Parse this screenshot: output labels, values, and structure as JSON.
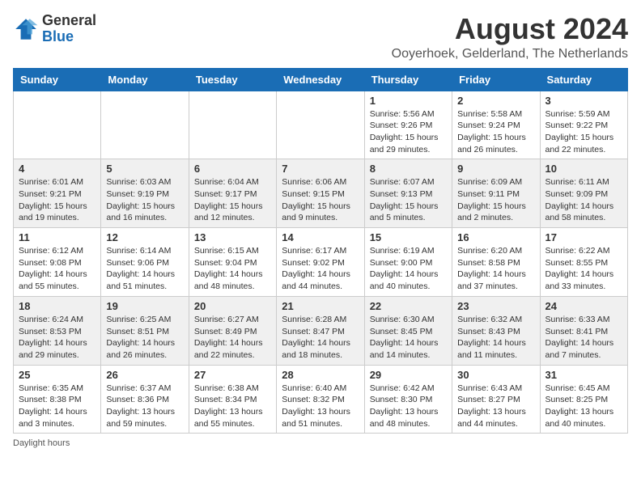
{
  "logo": {
    "line1": "General",
    "line2": "Blue"
  },
  "title": "August 2024",
  "subtitle": "Ooyerhoek, Gelderland, The Netherlands",
  "days_of_week": [
    "Sunday",
    "Monday",
    "Tuesday",
    "Wednesday",
    "Thursday",
    "Friday",
    "Saturday"
  ],
  "footer": "Daylight hours",
  "weeks": [
    [
      {
        "day": "",
        "info": ""
      },
      {
        "day": "",
        "info": ""
      },
      {
        "day": "",
        "info": ""
      },
      {
        "day": "",
        "info": ""
      },
      {
        "day": "1",
        "info": "Sunrise: 5:56 AM\nSunset: 9:26 PM\nDaylight: 15 hours\nand 29 minutes."
      },
      {
        "day": "2",
        "info": "Sunrise: 5:58 AM\nSunset: 9:24 PM\nDaylight: 15 hours\nand 26 minutes."
      },
      {
        "day": "3",
        "info": "Sunrise: 5:59 AM\nSunset: 9:22 PM\nDaylight: 15 hours\nand 22 minutes."
      }
    ],
    [
      {
        "day": "4",
        "info": "Sunrise: 6:01 AM\nSunset: 9:21 PM\nDaylight: 15 hours\nand 19 minutes."
      },
      {
        "day": "5",
        "info": "Sunrise: 6:03 AM\nSunset: 9:19 PM\nDaylight: 15 hours\nand 16 minutes."
      },
      {
        "day": "6",
        "info": "Sunrise: 6:04 AM\nSunset: 9:17 PM\nDaylight: 15 hours\nand 12 minutes."
      },
      {
        "day": "7",
        "info": "Sunrise: 6:06 AM\nSunset: 9:15 PM\nDaylight: 15 hours\nand 9 minutes."
      },
      {
        "day": "8",
        "info": "Sunrise: 6:07 AM\nSunset: 9:13 PM\nDaylight: 15 hours\nand 5 minutes."
      },
      {
        "day": "9",
        "info": "Sunrise: 6:09 AM\nSunset: 9:11 PM\nDaylight: 15 hours\nand 2 minutes."
      },
      {
        "day": "10",
        "info": "Sunrise: 6:11 AM\nSunset: 9:09 PM\nDaylight: 14 hours\nand 58 minutes."
      }
    ],
    [
      {
        "day": "11",
        "info": "Sunrise: 6:12 AM\nSunset: 9:08 PM\nDaylight: 14 hours\nand 55 minutes."
      },
      {
        "day": "12",
        "info": "Sunrise: 6:14 AM\nSunset: 9:06 PM\nDaylight: 14 hours\nand 51 minutes."
      },
      {
        "day": "13",
        "info": "Sunrise: 6:15 AM\nSunset: 9:04 PM\nDaylight: 14 hours\nand 48 minutes."
      },
      {
        "day": "14",
        "info": "Sunrise: 6:17 AM\nSunset: 9:02 PM\nDaylight: 14 hours\nand 44 minutes."
      },
      {
        "day": "15",
        "info": "Sunrise: 6:19 AM\nSunset: 9:00 PM\nDaylight: 14 hours\nand 40 minutes."
      },
      {
        "day": "16",
        "info": "Sunrise: 6:20 AM\nSunset: 8:58 PM\nDaylight: 14 hours\nand 37 minutes."
      },
      {
        "day": "17",
        "info": "Sunrise: 6:22 AM\nSunset: 8:55 PM\nDaylight: 14 hours\nand 33 minutes."
      }
    ],
    [
      {
        "day": "18",
        "info": "Sunrise: 6:24 AM\nSunset: 8:53 PM\nDaylight: 14 hours\nand 29 minutes."
      },
      {
        "day": "19",
        "info": "Sunrise: 6:25 AM\nSunset: 8:51 PM\nDaylight: 14 hours\nand 26 minutes."
      },
      {
        "day": "20",
        "info": "Sunrise: 6:27 AM\nSunset: 8:49 PM\nDaylight: 14 hours\nand 22 minutes."
      },
      {
        "day": "21",
        "info": "Sunrise: 6:28 AM\nSunset: 8:47 PM\nDaylight: 14 hours\nand 18 minutes."
      },
      {
        "day": "22",
        "info": "Sunrise: 6:30 AM\nSunset: 8:45 PM\nDaylight: 14 hours\nand 14 minutes."
      },
      {
        "day": "23",
        "info": "Sunrise: 6:32 AM\nSunset: 8:43 PM\nDaylight: 14 hours\nand 11 minutes."
      },
      {
        "day": "24",
        "info": "Sunrise: 6:33 AM\nSunset: 8:41 PM\nDaylight: 14 hours\nand 7 minutes."
      }
    ],
    [
      {
        "day": "25",
        "info": "Sunrise: 6:35 AM\nSunset: 8:38 PM\nDaylight: 14 hours\nand 3 minutes."
      },
      {
        "day": "26",
        "info": "Sunrise: 6:37 AM\nSunset: 8:36 PM\nDaylight: 13 hours\nand 59 minutes."
      },
      {
        "day": "27",
        "info": "Sunrise: 6:38 AM\nSunset: 8:34 PM\nDaylight: 13 hours\nand 55 minutes."
      },
      {
        "day": "28",
        "info": "Sunrise: 6:40 AM\nSunset: 8:32 PM\nDaylight: 13 hours\nand 51 minutes."
      },
      {
        "day": "29",
        "info": "Sunrise: 6:42 AM\nSunset: 8:30 PM\nDaylight: 13 hours\nand 48 minutes."
      },
      {
        "day": "30",
        "info": "Sunrise: 6:43 AM\nSunset: 8:27 PM\nDaylight: 13 hours\nand 44 minutes."
      },
      {
        "day": "31",
        "info": "Sunrise: 6:45 AM\nSunset: 8:25 PM\nDaylight: 13 hours\nand 40 minutes."
      }
    ]
  ]
}
